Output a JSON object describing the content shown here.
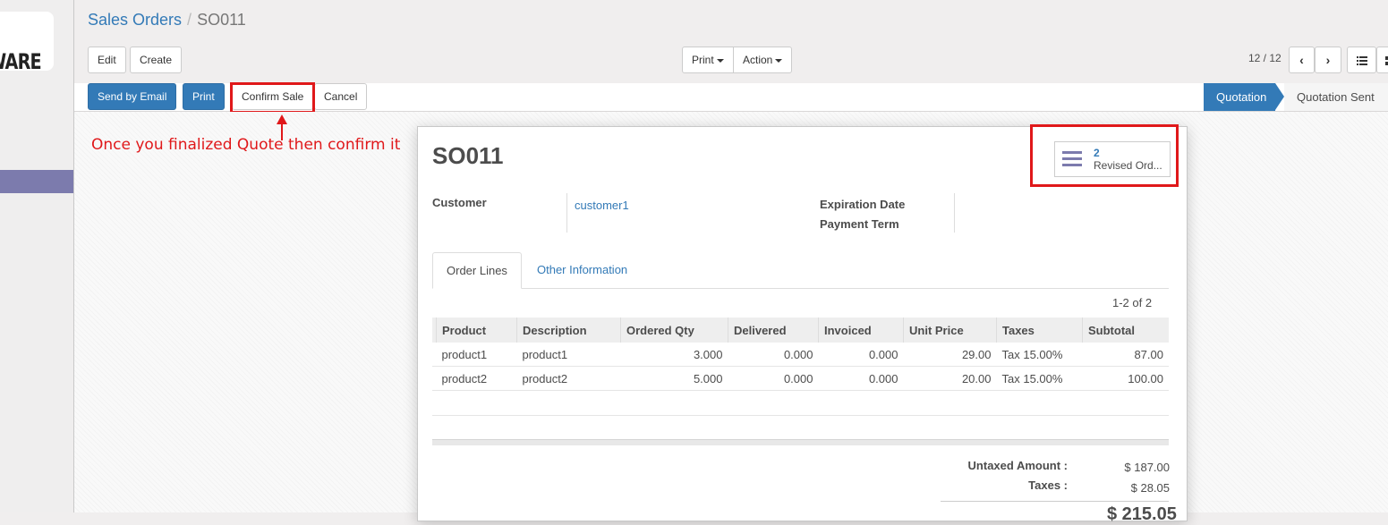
{
  "sidebar": {
    "logo_text": "WARE"
  },
  "breadcrumb": {
    "parent": "Sales Orders",
    "separator": "/",
    "current": "SO011"
  },
  "toolbar": {
    "edit": "Edit",
    "create": "Create",
    "print": "Print",
    "action": "Action"
  },
  "pager": {
    "value": "12 / 12"
  },
  "header_buttons": {
    "send_by_email": "Send by Email",
    "print": "Print",
    "confirm_sale": "Confirm Sale",
    "cancel": "Cancel"
  },
  "statusbar": {
    "active": "Quotation",
    "next": "Quotation Sent"
  },
  "annotation": "Once you finalized Quote then confirm it",
  "record": {
    "name": "SO011",
    "smart_button": {
      "count": "2",
      "label": "Revised Ord..."
    },
    "customer_label": "Customer",
    "customer": "customer1",
    "expiration_label": "Expiration Date",
    "payment_term_label": "Payment Term"
  },
  "tabs": {
    "order_lines": "Order Lines",
    "other_info": "Other Information"
  },
  "list_count": "1-2 of 2",
  "columns": [
    "Product",
    "Description",
    "Ordered Qty",
    "Delivered",
    "Invoiced",
    "Unit Price",
    "Taxes",
    "Subtotal"
  ],
  "lines": [
    {
      "product": "product1",
      "description": "product1",
      "qty": "3.000",
      "delivered": "0.000",
      "invoiced": "0.000",
      "price": "29.00",
      "taxes": "Tax 15.00%",
      "subtotal": "87.00"
    },
    {
      "product": "product2",
      "description": "product2",
      "qty": "5.000",
      "delivered": "0.000",
      "invoiced": "0.000",
      "price": "20.00",
      "taxes": "Tax 15.00%",
      "subtotal": "100.00"
    }
  ],
  "totals": {
    "untaxed_label": "Untaxed Amount :",
    "untaxed_value": "$ 187.00",
    "taxes_label": "Taxes :",
    "taxes_value": "$ 28.05",
    "total_value": "$ 215.05"
  },
  "colors": {
    "accent": "#337ab7",
    "highlight": "#e0181a",
    "menu_active": "#7c7bad"
  }
}
